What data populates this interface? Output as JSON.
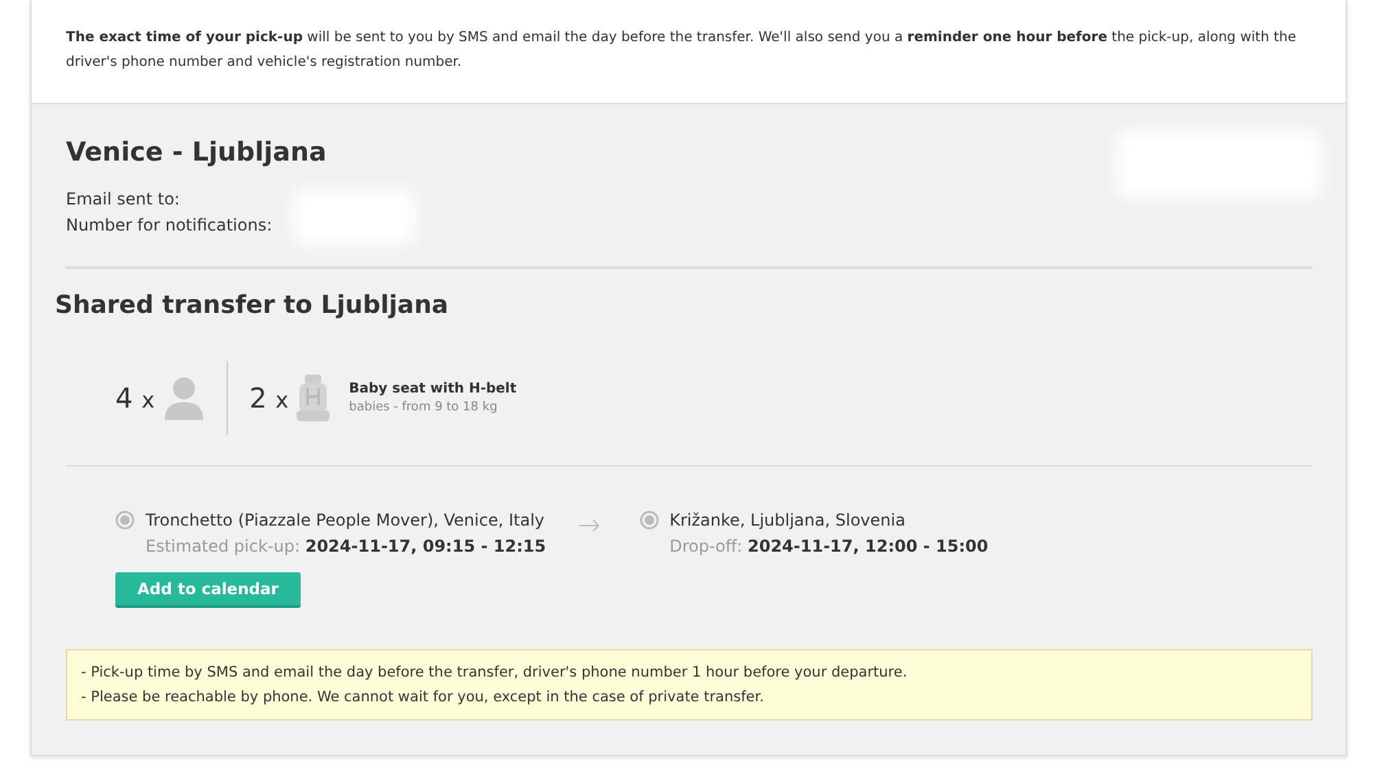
{
  "notice": "**The exact time of your pick-up** will be sent to you by SMS and email the day before the transfer. We'll also send you a **reminder one hour before** the pick-up, along with the driver's phone number and vehicle's registration number.",
  "route_title": "Venice - Ljubljana",
  "contact": [
    {
      "label": "Email sent to:"
    },
    {
      "label": "Number for notifications:"
    }
  ],
  "transfer_title": "Shared transfer to Ljubljana",
  "passengers": [
    {
      "kind": "person",
      "count": "4",
      "mult": "x"
    },
    {
      "kind": "seat",
      "count": "2",
      "mult": "x",
      "title": "Baby seat with H-belt",
      "subtitle": "babies - from 9 to 18 kg"
    }
  ],
  "pickup": {
    "place": "Tronchetto (Piazzale People Mover), Venice, Italy",
    "label": "Estimated pick-up:",
    "time": "2024-11-17, 09:15 - 12:15"
  },
  "dropoff": {
    "place": "Križanke, Ljubljana, Slovenia",
    "label": "Drop-off:",
    "time": "2024-11-17, 12:00 - 15:00"
  },
  "calendar_button": "Add to calendar",
  "notes": [
    "-  Pick-up time by SMS and email the day before the transfer, driver's phone number 1 hour before your departure.",
    "-  Please be reachable by phone. We cannot wait for you, except in the case of private transfer."
  ]
}
